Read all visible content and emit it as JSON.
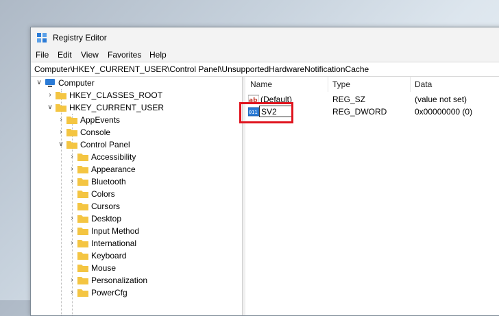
{
  "window": {
    "title": "Registry Editor"
  },
  "menu": [
    "File",
    "Edit",
    "View",
    "Favorites",
    "Help"
  ],
  "address": "Computer\\HKEY_CURRENT_USER\\Control Panel\\UnsupportedHardwareNotificationCache",
  "tree": {
    "root": "Computer",
    "items": [
      "HKEY_CLASSES_ROOT",
      "HKEY_CURRENT_USER",
      "AppEvents",
      "Console",
      "Control Panel",
      "Accessibility",
      "Appearance",
      "Bluetooth",
      "Colors",
      "Cursors",
      "Desktop",
      "Input Method",
      "International",
      "Keyboard",
      "Mouse",
      "Personalization",
      "PowerCfg"
    ]
  },
  "list": {
    "headers": {
      "name": "Name",
      "type": "Type",
      "data": "Data"
    },
    "rows": [
      {
        "name": "(Default)",
        "type": "REG_SZ",
        "data": "(value not set)",
        "icon": "string-value-icon"
      },
      {
        "name": "SV2",
        "type": "REG_DWORD",
        "data": "0x00000000 (0)",
        "icon": "dword-value-icon"
      }
    ]
  },
  "colors": {
    "highlight": "#e0141e",
    "folder": "#f4c542",
    "computer": "#2b7bd6"
  }
}
